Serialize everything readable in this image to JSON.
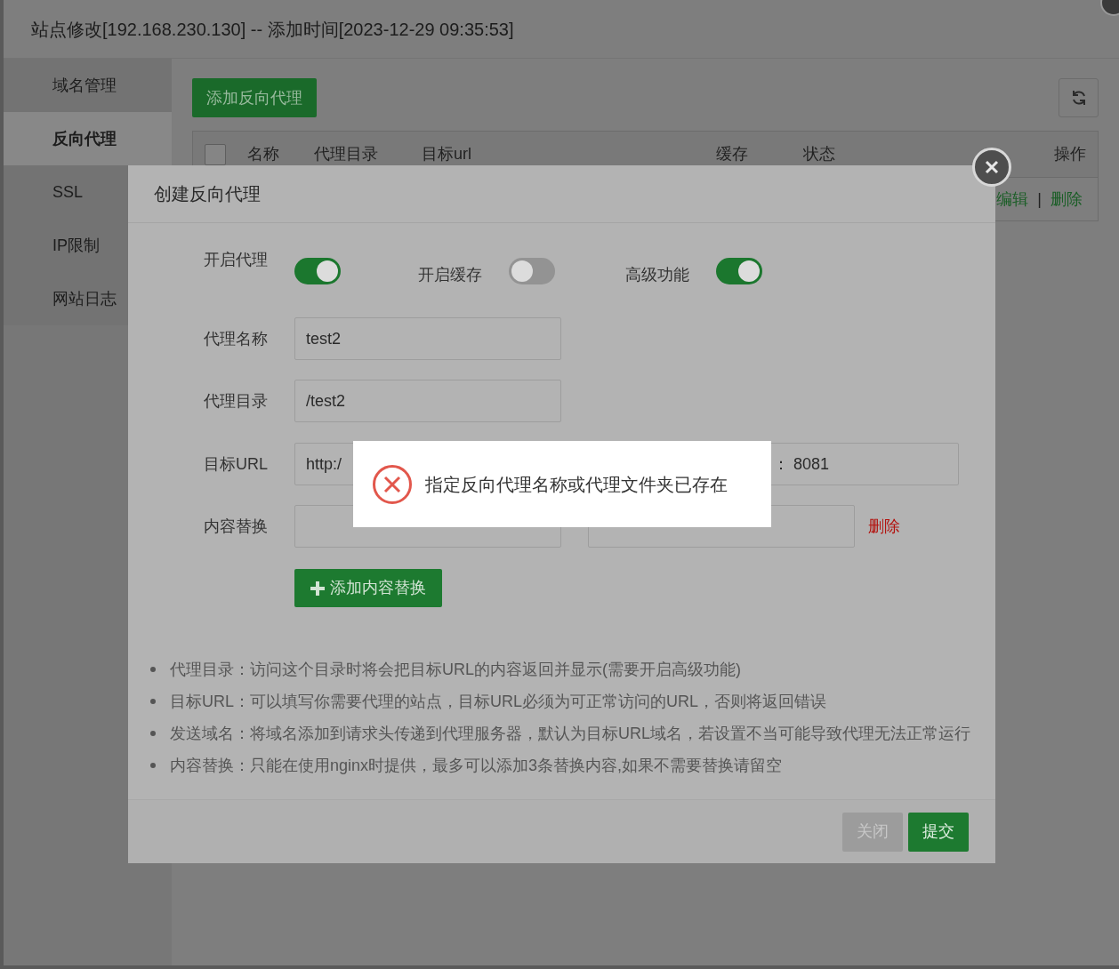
{
  "window": {
    "title": "站点修改[192.168.230.130] -- 添加时间[2023-12-29 09:35:53]"
  },
  "sidebar": {
    "items": [
      {
        "label": "域名管理",
        "selected": false
      },
      {
        "label": "反向代理",
        "selected": true
      },
      {
        "label": "SSL",
        "selected": false
      },
      {
        "label": "IP限制",
        "selected": false
      },
      {
        "label": "网站日志",
        "selected": false
      }
    ]
  },
  "toolbar": {
    "add_button": "添加反向代理"
  },
  "table": {
    "select_all_checked": false,
    "columns": [
      "名称",
      "代理目录",
      "目标url",
      "缓存",
      "状态",
      "操作"
    ],
    "rows": [
      {
        "actions": [
          "编辑",
          "删除"
        ],
        "separator": "|"
      }
    ]
  },
  "modal": {
    "title": "创建反向代理",
    "toggles": [
      {
        "label": "开启代理",
        "on": true
      },
      {
        "label": "开启缓存",
        "on": false
      },
      {
        "label": "高级功能",
        "on": true
      }
    ],
    "fields": [
      {
        "label": "代理名称",
        "value": "test2"
      },
      {
        "label": "代理目录",
        "value": "/test2"
      }
    ],
    "target_url": {
      "label": "目标URL",
      "value": "http:/",
      "value_2": "：  8081"
    },
    "content_replace": {
      "label": "内容替换",
      "delete": "删除"
    },
    "add_replace_button": "添加内容替换",
    "notes": [
      "代理目录：访问这个目录时将会把目标URL的内容返回并显示(需要开启高级功能)",
      "目标URL：可以填写你需要代理的站点，目标URL必须为可正常访问的URL，否则将返回错误",
      "发送域名：将域名添加到请求头传递到代理服务器，默认为目标URL域名，若设置不当可能导致代理无法正常运行",
      "内容替换：只能在使用nginx时提供，最多可以添加3条替换内容,如果不需要替换请留空"
    ],
    "buttons": [
      {
        "label": "关闭",
        "kind": "secondary"
      },
      {
        "label": "提交",
        "kind": "primary"
      }
    ]
  },
  "toast": {
    "kind": "error",
    "message": "指定反向代理名称或代理文件夹已存在"
  }
}
